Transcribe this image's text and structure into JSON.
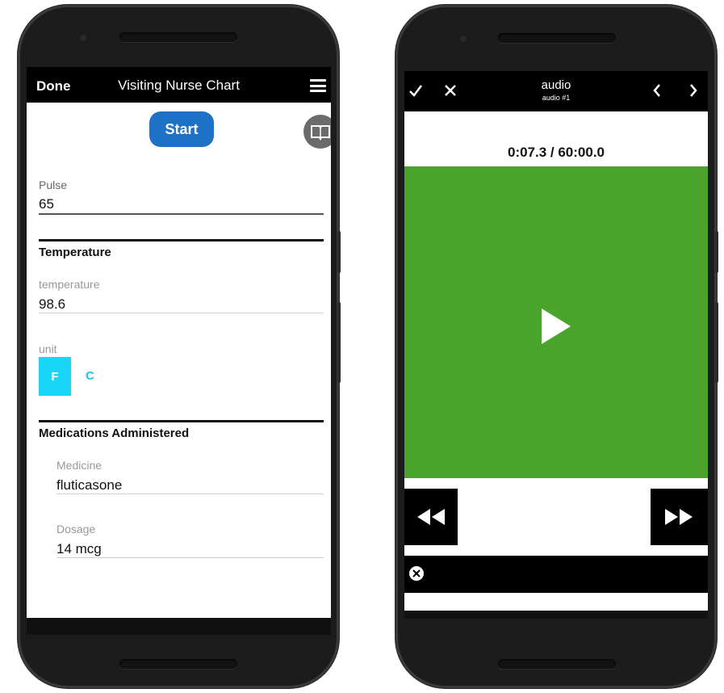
{
  "left_app": {
    "topbar": {
      "done_label": "Done",
      "title": "Visiting Nurse Chart",
      "menu_icon": "hamburger-menu-icon"
    },
    "start_label": "Start",
    "book_icon": "open-book-icon",
    "pulse": {
      "label": "Pulse",
      "value": "65"
    },
    "temperature_section": {
      "title": "Temperature",
      "temperature": {
        "label": "temperature",
        "value": "98.6"
      },
      "unit": {
        "label": "unit",
        "options": [
          "F",
          "C"
        ],
        "selected": "F"
      }
    },
    "medications_section": {
      "title": "Medications Administered",
      "medicine": {
        "label": "Medicine",
        "value": "fluticasone"
      },
      "dosage": {
        "label": "Dosage",
        "value": "14 mcg"
      }
    }
  },
  "right_app": {
    "topbar": {
      "title": "audio",
      "subtitle": "audio #1",
      "confirm_icon": "checkmark-icon",
      "close_icon": "close-icon",
      "prev_icon": "chevron-left-icon",
      "next_icon": "chevron-right-icon"
    },
    "timer": "0:07.3 / 60:00.0",
    "player": {
      "play_icon": "play-icon",
      "background_color": "#4aa32a"
    },
    "rewind_icon": "rewind-icon",
    "fast_forward_icon": "fast-forward-icon",
    "clear_icon": "circle-x-icon"
  },
  "colors": {
    "primary_button": "#1d71c6",
    "unit_selected": "#19d6f7",
    "player_green": "#4aa32a"
  }
}
